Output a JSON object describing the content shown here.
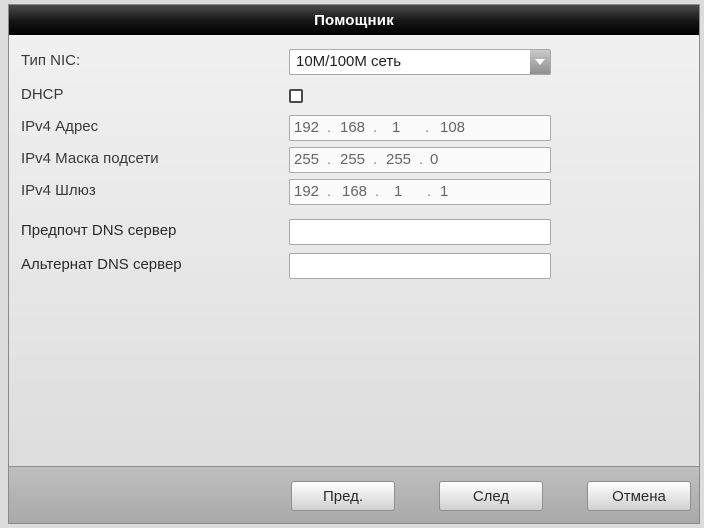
{
  "dialog": {
    "title": "Помощник"
  },
  "nic_type": {
    "label": "Тип NIC:",
    "value": "10M/100M сеть"
  },
  "dhcp": {
    "label": "DHCP",
    "checked": false
  },
  "ipv4_address": {
    "label": "IPv4 Адрес",
    "parts": [
      "192",
      "168",
      "1",
      "108"
    ]
  },
  "ipv4_mask": {
    "label": "IPv4 Маска подсети",
    "parts": [
      "255",
      "255",
      "255",
      "0"
    ]
  },
  "ipv4_gateway": {
    "label": "IPv4 Шлюз",
    "parts": [
      "192",
      "168",
      "1",
      "1"
    ]
  },
  "preferred_dns": {
    "label": "Предпочт DNS сервер",
    "value": ""
  },
  "alternate_dns": {
    "label": "Альтернат DNS сервер",
    "value": ""
  },
  "footer": {
    "prev_label": "Пред.",
    "next_label": "След",
    "cancel_label": "Отмена"
  },
  "icons": {
    "dropdown": "chevron-down-icon"
  }
}
